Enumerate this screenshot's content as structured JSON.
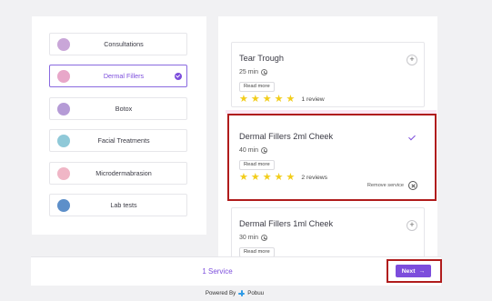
{
  "categories": [
    {
      "label": "Consultations",
      "avatar_color": "#c9a6d8"
    },
    {
      "label": "Dermal Fillers",
      "avatar_color": "#e8a7c9",
      "selected": true
    },
    {
      "label": "Botox",
      "avatar_color": "#b59bd6"
    },
    {
      "label": "Facial Treatments",
      "avatar_color": "#8fc9d8"
    },
    {
      "label": "Microdermabrasion",
      "avatar_color": "#f0b6c6"
    },
    {
      "label": "Lab tests",
      "avatar_color": "#5d8fc9"
    }
  ],
  "services": [
    {
      "name": "Tear Trough",
      "duration": "25 min",
      "read_more": "Read more",
      "rating": 5,
      "reviews": "1 review",
      "action": "+"
    },
    {
      "name": "Dermal Fillers 2ml Cheek",
      "duration": "40 min",
      "read_more": "Read more",
      "rating": 5,
      "reviews": "2 reviews",
      "selected": true,
      "remove_label": "Remove service"
    },
    {
      "name": "Dermal Fillers 1ml Cheek",
      "duration": "30 min",
      "read_more": "Read more",
      "action": "+"
    }
  ],
  "footer": {
    "service_count": "1 Service",
    "next_label": "Next",
    "next_arrow": "→",
    "powered_by": "Powered By",
    "brand": "Pobuu"
  },
  "colors": {
    "accent": "#7c4ddc",
    "star": "#f2cd1a",
    "highlight": "#b01c1c"
  }
}
